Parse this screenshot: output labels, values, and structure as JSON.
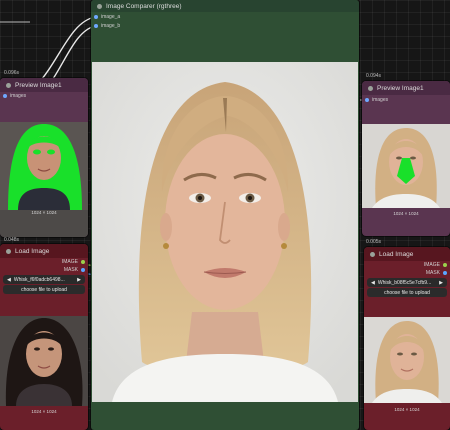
{
  "comparer": {
    "title": "Image Comparer (rgthree)",
    "inputs": [
      "image_a",
      "image_b"
    ]
  },
  "preview_left": {
    "time": "0.096s",
    "title": "Preview Image1",
    "input": "images",
    "dimensions": "1024 × 1024"
  },
  "load_left": {
    "time": "0.048s",
    "title": "Load Image",
    "outputs": [
      "IMAGE",
      "MASK"
    ],
    "file": "Whisk_f6f0adcb6498...",
    "upload_label": "choose file to upload",
    "dimensions": "1024 × 1024"
  },
  "preview_right": {
    "time": "0.094s",
    "title": "Preview Image1",
    "input": "images",
    "dimensions": "1024 × 1024"
  },
  "load_right": {
    "time": "0.005s",
    "title": "Load Image",
    "outputs": [
      "IMAGE",
      "MASK"
    ],
    "file": "Whisk_b08f5c5e7cfb9...",
    "upload_label": "choose file to upload",
    "dimensions": "1024 × 1024"
  },
  "colors": {
    "comparer_green": "#2f4f34",
    "preview_purple": "#5a3550",
    "load_red": "#6b1f2a",
    "mask_green": "#19e02a"
  }
}
